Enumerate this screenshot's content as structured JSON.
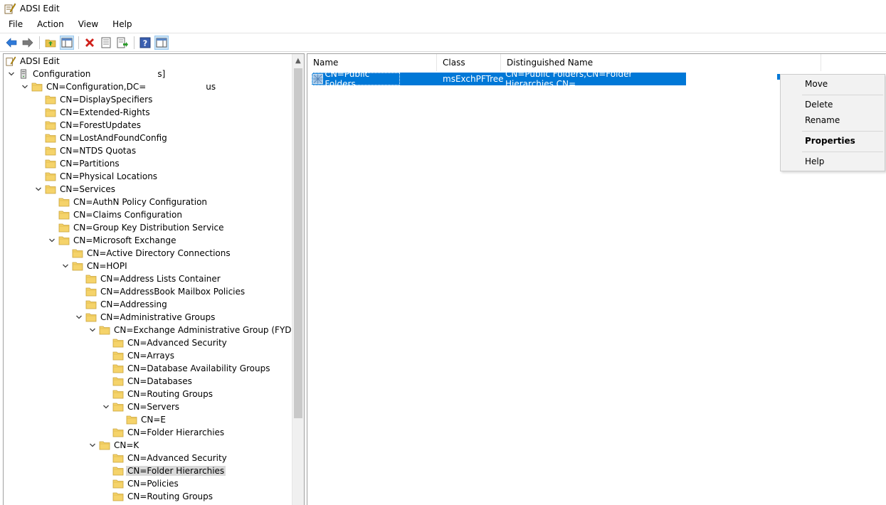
{
  "window": {
    "title": "ADSI Edit"
  },
  "menu": [
    "File",
    "Action",
    "View",
    "Help"
  ],
  "toolbar": {
    "buttons": [
      "back-icon",
      "forward-icon",
      "up-folder-icon",
      "show-hide-tree-icon",
      "delete-icon",
      "properties-icon",
      "export-list-icon",
      "help-icon",
      "show-hide-action-pane-icon"
    ]
  },
  "tree": {
    "root": "ADSI Edit",
    "items": [
      {
        "label": "Configuration",
        "label_suffix": "s]",
        "level": 0,
        "chevron": "down",
        "icon": "server"
      },
      {
        "label": "CN=Configuration,DC=",
        "label_suffix": "us",
        "level": 1,
        "chevron": "down"
      },
      {
        "label": "CN=DisplaySpecifiers",
        "level": 2
      },
      {
        "label": "CN=Extended-Rights",
        "level": 2
      },
      {
        "label": "CN=ForestUpdates",
        "level": 2
      },
      {
        "label": "CN=LostAndFoundConfig",
        "level": 2
      },
      {
        "label": "CN=NTDS Quotas",
        "level": 2
      },
      {
        "label": "CN=Partitions",
        "level": 2
      },
      {
        "label": "CN=Physical Locations",
        "level": 2
      },
      {
        "label": "CN=Services",
        "level": 2,
        "chevron": "down"
      },
      {
        "label": "CN=AuthN Policy Configuration",
        "level": 3
      },
      {
        "label": "CN=Claims Configuration",
        "level": 3
      },
      {
        "label": "CN=Group Key Distribution Service",
        "level": 3
      },
      {
        "label": "CN=Microsoft Exchange",
        "level": 3,
        "chevron": "down"
      },
      {
        "label": "CN=Active Directory Connections",
        "level": 4
      },
      {
        "label": "CN=HOPI",
        "level": 4,
        "chevron": "down"
      },
      {
        "label": "CN=Address Lists Container",
        "level": 5
      },
      {
        "label": "CN=AddressBook Mailbox Policies",
        "level": 5
      },
      {
        "label": "CN=Addressing",
        "level": 5
      },
      {
        "label": "CN=Administrative Groups",
        "level": 5,
        "chevron": "down"
      },
      {
        "label": "CN=Exchange Administrative Group (FYDIBOH",
        "level": 6,
        "chevron": "down"
      },
      {
        "label": "CN=Advanced Security",
        "level": 7
      },
      {
        "label": "CN=Arrays",
        "level": 7
      },
      {
        "label": "CN=Database Availability Groups",
        "level": 7
      },
      {
        "label": "CN=Databases",
        "level": 7
      },
      {
        "label": "CN=Routing Groups",
        "level": 7
      },
      {
        "label": "CN=Servers",
        "level": 7,
        "chevron": "down"
      },
      {
        "label": "CN=E",
        "level": 8
      },
      {
        "label": "CN=Folder Hierarchies",
        "level": 7
      },
      {
        "label": "CN=K",
        "level": 6,
        "chevron": "down"
      },
      {
        "label": "CN=Advanced Security",
        "level": 7
      },
      {
        "label": "CN=Folder Hierarchies",
        "level": 7,
        "selected": true
      },
      {
        "label": "CN=Policies",
        "level": 7
      },
      {
        "label": "CN=Routing Groups",
        "level": 7
      }
    ]
  },
  "list": {
    "columns": [
      "Name",
      "Class",
      "Distinguished Name"
    ],
    "rows": [
      {
        "name": "CN=Public Folders",
        "class": "msExchPFTree",
        "dn": "CN=Public Folders,CN=Folder Hierarchies,CN="
      }
    ]
  },
  "context_menu": {
    "items": [
      {
        "label": "Move"
      },
      {
        "label": "Delete"
      },
      {
        "label": "Rename"
      },
      {
        "label": "Properties",
        "bold": true
      },
      {
        "label": "Help"
      }
    ]
  },
  "colors": {
    "selection": "#0078d7",
    "tree_selected": "#d9d9d9",
    "folder": "#f5d36a"
  }
}
